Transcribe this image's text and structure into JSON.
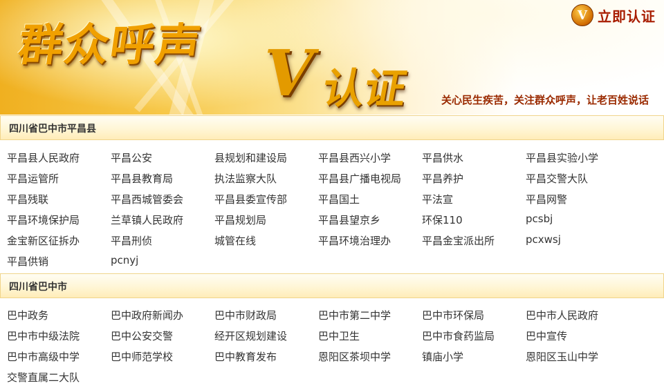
{
  "banner": {
    "title_main": "群众呼声",
    "title_v": "V",
    "title_renzheng": "认证",
    "slogan": "关心民生疾苦，关注群众呼声，让老百姓说话",
    "verify_icon": "V",
    "verify_label": "立即认证",
    "accent": "#e9a100"
  },
  "sections": [
    {
      "title": "四川省巴中市平昌县",
      "links": [
        "平昌县人民政府",
        "平昌公安",
        "县规划和建设局",
        "平昌县西兴小学",
        "平昌供水",
        "平昌县实验小学",
        "平昌运管所",
        "平昌县教育局",
        "执法监察大队",
        "平昌县广播电视局",
        "平昌养护",
        "平昌交警大队",
        "平昌残联",
        "平昌西城管委会",
        "平昌县委宣传部",
        "平昌国土",
        "平法宣",
        "平昌网警",
        "平昌环境保护局",
        "兰草镇人民政府",
        "平昌规划局",
        "平昌县望京乡",
        "环保110",
        "pcsbj",
        "金宝新区征拆办",
        "平昌刑侦",
        "城管在线",
        "平昌环境治理办",
        "平昌金宝派出所",
        "pcxwsj",
        "平昌供销",
        "pcnyj"
      ]
    },
    {
      "title": "四川省巴中市",
      "links": [
        "巴中政务",
        "巴中政府新闻办",
        "巴中市财政局",
        "巴中市第二中学",
        "巴中市环保局",
        "巴中市人民政府",
        "巴中市中级法院",
        "巴中公安交警",
        "经开区规划建设",
        "巴中卫生",
        "巴中市食药监局",
        "巴中宣传",
        "巴中市高级中学",
        "巴中师范学校",
        "巴中教育发布",
        "恩阳区茶坝中学",
        "镇庙小学",
        "恩阳区玉山中学",
        "交警直属二大队"
      ]
    }
  ]
}
